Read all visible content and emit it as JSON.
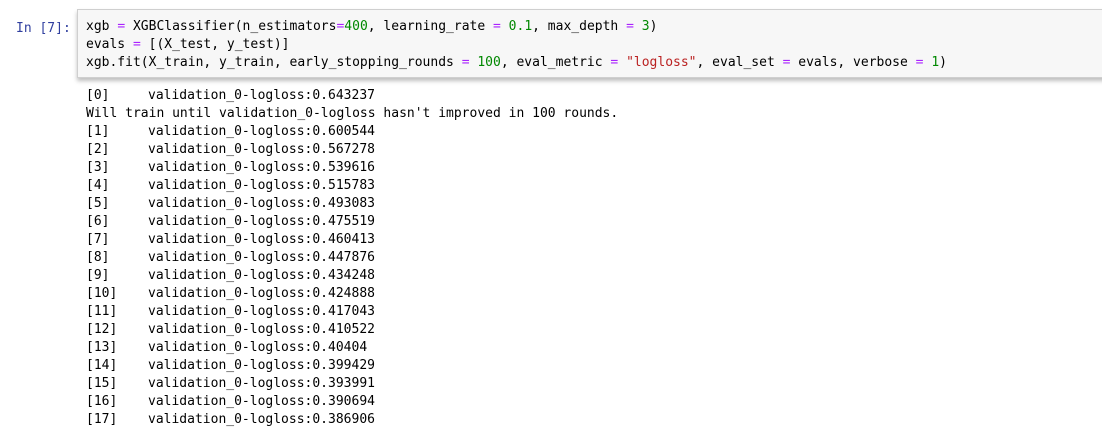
{
  "cell": {
    "prompt": "In [7]:",
    "code_lines": [
      [
        {
          "t": "xgb ",
          "c": ""
        },
        {
          "t": "=",
          "c": "op"
        },
        {
          "t": " XGBClassifier(n_estimators",
          "c": ""
        },
        {
          "t": "=",
          "c": "op"
        },
        {
          "t": "400",
          "c": "num"
        },
        {
          "t": ", learning_rate ",
          "c": ""
        },
        {
          "t": "=",
          "c": "op"
        },
        {
          "t": " ",
          "c": ""
        },
        {
          "t": "0.1",
          "c": "num"
        },
        {
          "t": ", max_depth ",
          "c": ""
        },
        {
          "t": "=",
          "c": "op"
        },
        {
          "t": " ",
          "c": ""
        },
        {
          "t": "3",
          "c": "num"
        },
        {
          "t": ")",
          "c": ""
        }
      ],
      [
        {
          "t": "evals ",
          "c": ""
        },
        {
          "t": "=",
          "c": "op"
        },
        {
          "t": " [(X_test, y_test)]",
          "c": ""
        }
      ],
      [
        {
          "t": "xgb.fit(X_train, y_train, early_stopping_rounds ",
          "c": ""
        },
        {
          "t": "=",
          "c": "op"
        },
        {
          "t": " ",
          "c": ""
        },
        {
          "t": "100",
          "c": "num"
        },
        {
          "t": ", eval_metric ",
          "c": ""
        },
        {
          "t": "=",
          "c": "op"
        },
        {
          "t": " ",
          "c": ""
        },
        {
          "t": "\"logloss\"",
          "c": "str"
        },
        {
          "t": ", eval_set ",
          "c": ""
        },
        {
          "t": "=",
          "c": "op"
        },
        {
          "t": " evals, verbose ",
          "c": ""
        },
        {
          "t": "=",
          "c": "op"
        },
        {
          "t": " ",
          "c": ""
        },
        {
          "t": "1",
          "c": "num"
        },
        {
          "t": ")",
          "c": ""
        }
      ]
    ]
  },
  "output": {
    "lines": [
      {
        "index": "[0]",
        "text": "validation_0-logloss:0.643237"
      },
      {
        "index": "",
        "text": "Will train until validation_0-logloss hasn't improved in 100 rounds."
      },
      {
        "index": "[1]",
        "text": "validation_0-logloss:0.600544"
      },
      {
        "index": "[2]",
        "text": "validation_0-logloss:0.567278"
      },
      {
        "index": "[3]",
        "text": "validation_0-logloss:0.539616"
      },
      {
        "index": "[4]",
        "text": "validation_0-logloss:0.515783"
      },
      {
        "index": "[5]",
        "text": "validation_0-logloss:0.493083"
      },
      {
        "index": "[6]",
        "text": "validation_0-logloss:0.475519"
      },
      {
        "index": "[7]",
        "text": "validation_0-logloss:0.460413"
      },
      {
        "index": "[8]",
        "text": "validation_0-logloss:0.447876"
      },
      {
        "index": "[9]",
        "text": "validation_0-logloss:0.434248"
      },
      {
        "index": "[10]",
        "text": "validation_0-logloss:0.424888"
      },
      {
        "index": "[11]",
        "text": "validation_0-logloss:0.417043"
      },
      {
        "index": "[12]",
        "text": "validation_0-logloss:0.410522"
      },
      {
        "index": "[13]",
        "text": "validation_0-logloss:0.40404"
      },
      {
        "index": "[14]",
        "text": "validation_0-logloss:0.399429"
      },
      {
        "index": "[15]",
        "text": "validation_0-logloss:0.393991"
      },
      {
        "index": "[16]",
        "text": "validation_0-logloss:0.390694"
      },
      {
        "index": "[17]",
        "text": "validation_0-logloss:0.386906"
      }
    ]
  },
  "colors": {
    "prompt": "#303f9f",
    "number": "#008800",
    "string": "#ba2121",
    "operator": "#aa22ff",
    "input_background": "#f7f7f7"
  }
}
